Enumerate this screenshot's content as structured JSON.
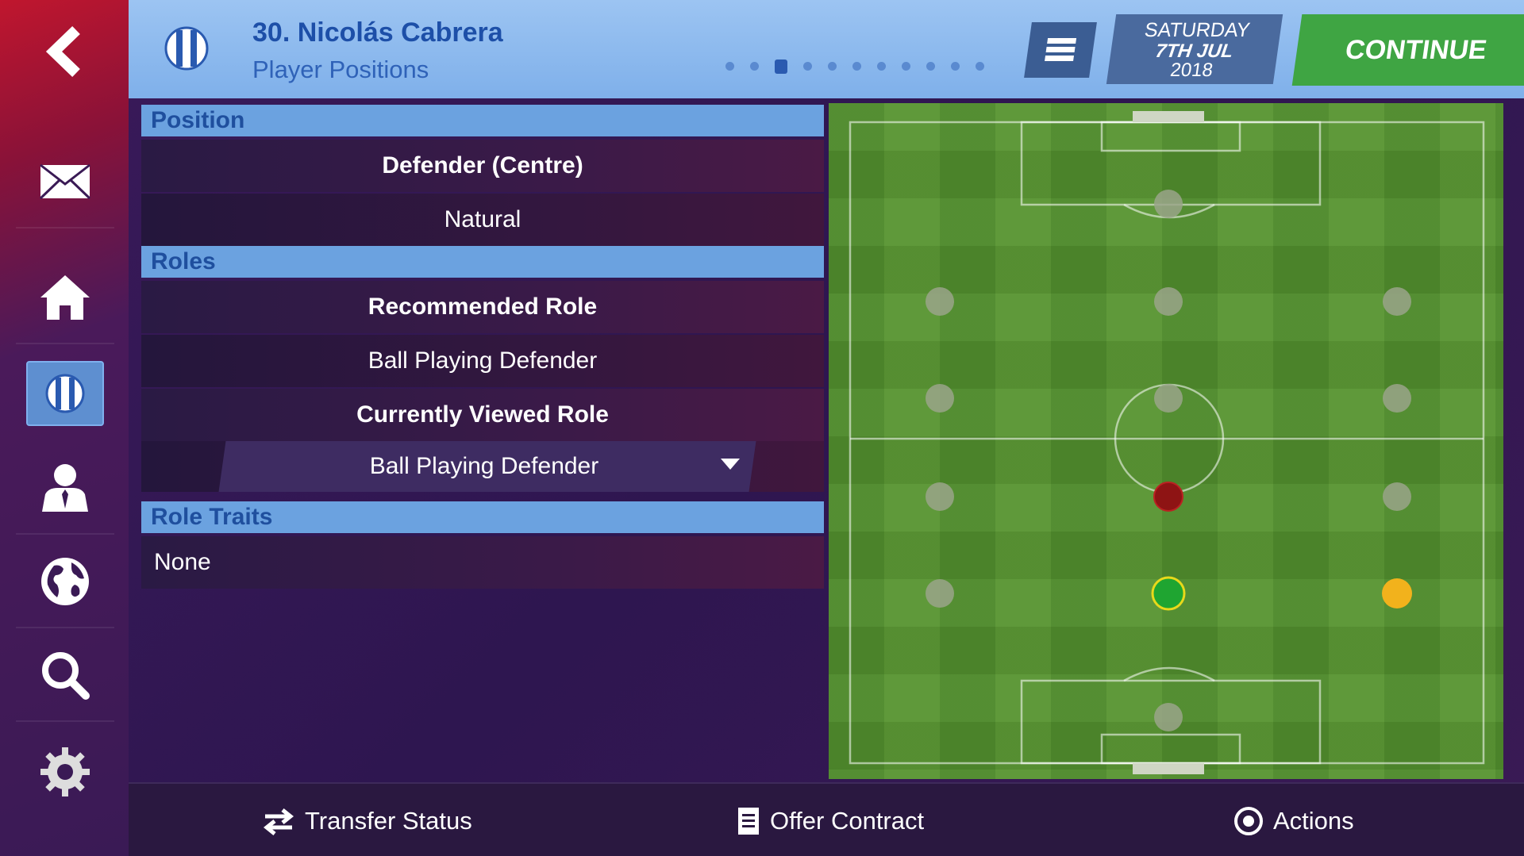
{
  "header": {
    "player_name": "30. Nicolás Cabrera",
    "page_title": "Player Positions",
    "date_day": "SATURDAY",
    "date_main": "7TH JUL",
    "date_year": "2018",
    "continue_label": "CONTINUE",
    "page_dots": 11,
    "active_dot": 3
  },
  "sidebar": {
    "items": [
      {
        "name": "back",
        "icon": "chevron-left-icon"
      },
      {
        "name": "inbox",
        "icon": "mail-icon"
      },
      {
        "name": "home",
        "icon": "home-icon"
      },
      {
        "name": "club",
        "icon": "club-badge-icon",
        "active": true
      },
      {
        "name": "manager",
        "icon": "person-icon"
      },
      {
        "name": "world",
        "icon": "globe-icon"
      },
      {
        "name": "search",
        "icon": "search-icon"
      },
      {
        "name": "settings",
        "icon": "gear-icon"
      }
    ]
  },
  "position": {
    "section_label": "Position",
    "name": "Defender (Centre)",
    "rating": "Natural"
  },
  "roles": {
    "section_label": "Roles",
    "recommended_label": "Recommended Role",
    "recommended_value": "Ball Playing Defender",
    "current_label": "Currently Viewed Role",
    "current_value": "Ball Playing Defender"
  },
  "traits": {
    "section_label": "Role Traits",
    "value": "None"
  },
  "pitch": {
    "markers": [
      {
        "status": "natural",
        "color": "#1fa531"
      },
      {
        "status": "competent",
        "color": "#f2b21c"
      },
      {
        "status": "ineffective",
        "color": "#8e1414"
      },
      {
        "status": "unavailable",
        "color": "#9aa48a"
      }
    ]
  },
  "bottom_bar": {
    "transfer_label": "Transfer Status",
    "contract_label": "Offer Contract",
    "actions_label": "Actions"
  }
}
